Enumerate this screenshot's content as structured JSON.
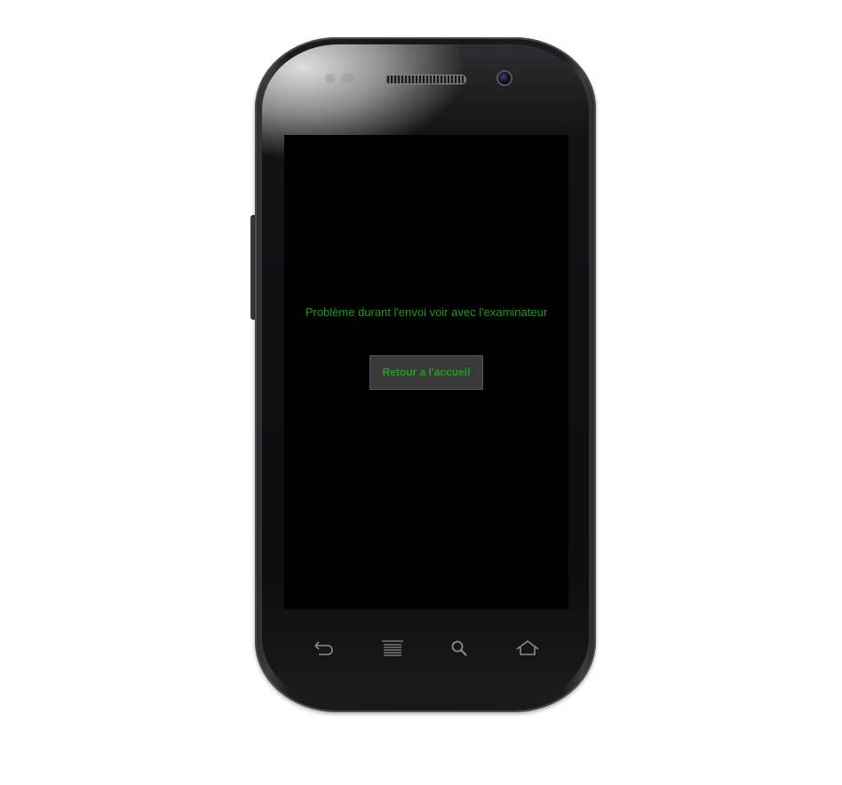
{
  "screen": {
    "message": "Problème durant l'envoi voir avec l'examinateur",
    "home_button_label": "Retour a l'accueil"
  },
  "device": {
    "softkeys": [
      "back-icon",
      "menu-icon",
      "search-icon",
      "home-icon"
    ]
  },
  "colors": {
    "text_green": "#1e9c1e",
    "screen_bg": "#000000",
    "button_bg": "#3a3a3a"
  }
}
